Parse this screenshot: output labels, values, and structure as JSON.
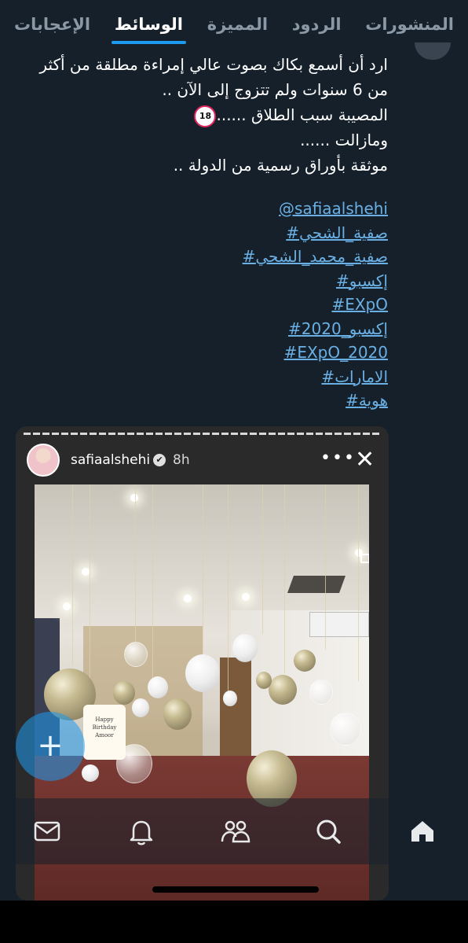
{
  "tabs": [
    {
      "label": "المنشورات",
      "active": false
    },
    {
      "label": "الردود",
      "active": false
    },
    {
      "label": "المميزة",
      "active": false
    },
    {
      "label": "الوسائط",
      "active": true
    },
    {
      "label": "الإعجابات",
      "active": false
    }
  ],
  "post": {
    "lines": [
      "ارد أن أسمع بكاك بصوت عالي إمراءة مطلقة من أكثر",
      "من 6 سنوات ولم تتزوج إلى الآن ..",
      "المصيبة سبب الطلاق ......",
      "ومازالت ......",
      "موثقة بأوراق رسمية من الدولة .."
    ],
    "warning_badge": "18",
    "links": [
      "@safiaalshehi",
      "#صفية_الشحي",
      "#صفية_محمد_الشحي",
      "#إكسبو",
      "#EXpO",
      "#إكسبو_2020",
      "#EXpO_2020",
      "#الامارات",
      "#هوية"
    ],
    "link_color": "#6ab0e4"
  },
  "story": {
    "username": "safiaalshehi",
    "verified_mark": "✔",
    "time": "8h",
    "more_label": "•••",
    "close_label": "✕",
    "sign_text": [
      "Happy",
      "Birthday",
      "Amoor"
    ]
  },
  "fab": {
    "label": "+"
  },
  "bottom_nav": [
    {
      "name": "home",
      "icon": "home-icon"
    },
    {
      "name": "search",
      "icon": "search-icon"
    },
    {
      "name": "communities",
      "icon": "communities-icon"
    },
    {
      "name": "notifications",
      "icon": "bell-icon"
    },
    {
      "name": "messages",
      "icon": "mail-icon"
    }
  ],
  "colors": {
    "background": "#15202b",
    "accent": "#1d9bf0",
    "muted": "#8b98a5"
  }
}
